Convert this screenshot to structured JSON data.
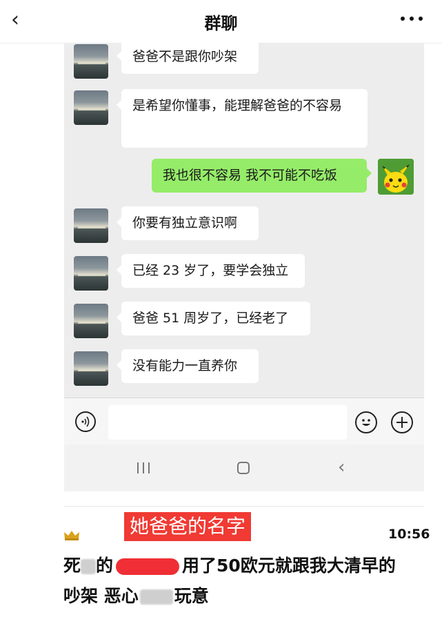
{
  "header": {
    "back_icon": "chevron-left-icon",
    "title": "群聊",
    "more_icon": "more-dots-icon"
  },
  "messages": [
    {
      "side": "left",
      "text": "爸爸不是跟你吵架"
    },
    {
      "side": "left",
      "text": "是希望你懂事，能理解爸爸的不容易"
    },
    {
      "side": "right",
      "text": "我也很不容易 我不可能不吃饭"
    },
    {
      "side": "left",
      "text": "你要有独立意识啊"
    },
    {
      "side": "left",
      "text": "已经 23 岁了，要学会独立"
    },
    {
      "side": "left",
      "text": "爸爸 51 周岁了，已经老了"
    },
    {
      "side": "left",
      "text": "没有能力一直养你"
    }
  ],
  "input_bar": {
    "voice_icon": "voice-icon",
    "text_value": "",
    "emoji_icon": "emoji-icon",
    "plus_icon": "plus-icon"
  },
  "nav": {
    "recent_icon": "recent-apps-icon",
    "home_icon": "home-icon",
    "back_icon": "back-icon"
  },
  "comment": {
    "badge_icon": "crown-icon",
    "name_tag": "她爸爸的名字",
    "time": "10:56",
    "line1_a": "死",
    "line1_b": "的",
    "line1_c": "用了50欧元就跟我大清早的",
    "line2_a": "吵架 恶心",
    "line2_b": "玩意"
  },
  "colors": {
    "chat_bg": "#ededed",
    "self_bubble": "#95ec69",
    "other_bubble": "#ffffff",
    "name_tag_bg": "#f03a33"
  }
}
